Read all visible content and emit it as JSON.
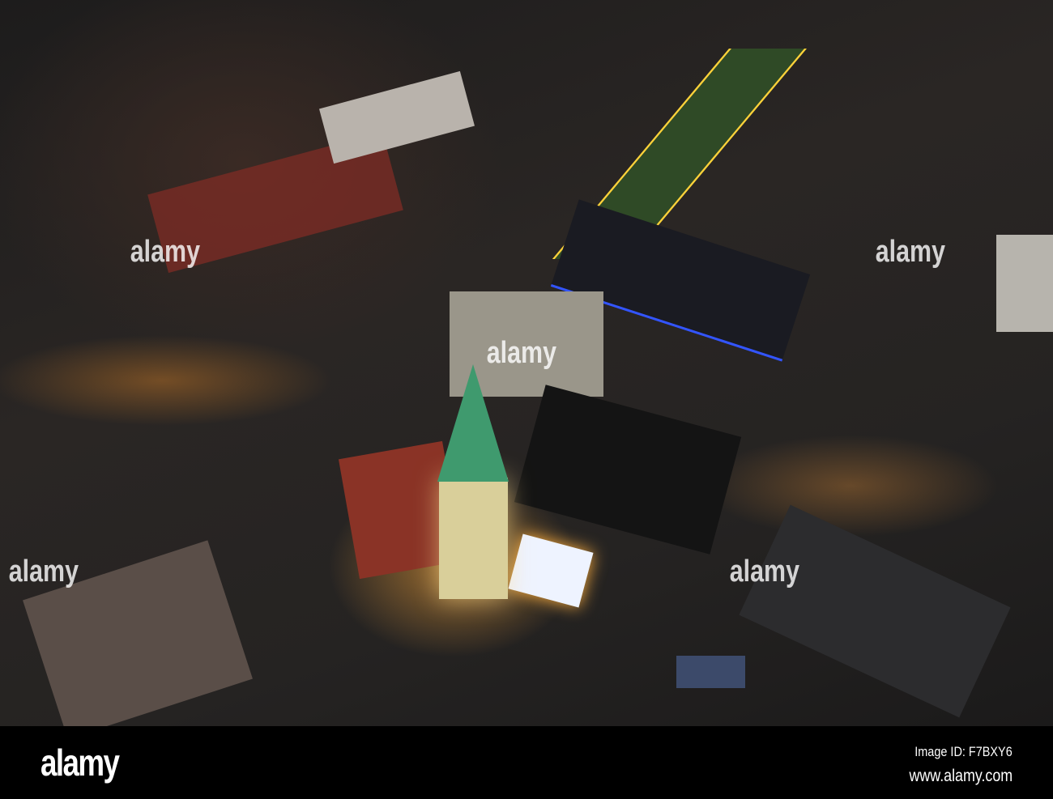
{
  "watermark": {
    "logo": "alamy",
    "image_id": "Image ID: F7BXY6",
    "site": "www.alamy.com"
  },
  "colors": {
    "spire": "#3f9a6e",
    "tower": "#d9cf9a",
    "roof_red": "#8a3326",
    "glow": "#ffb040",
    "park": "#2f4a26"
  }
}
